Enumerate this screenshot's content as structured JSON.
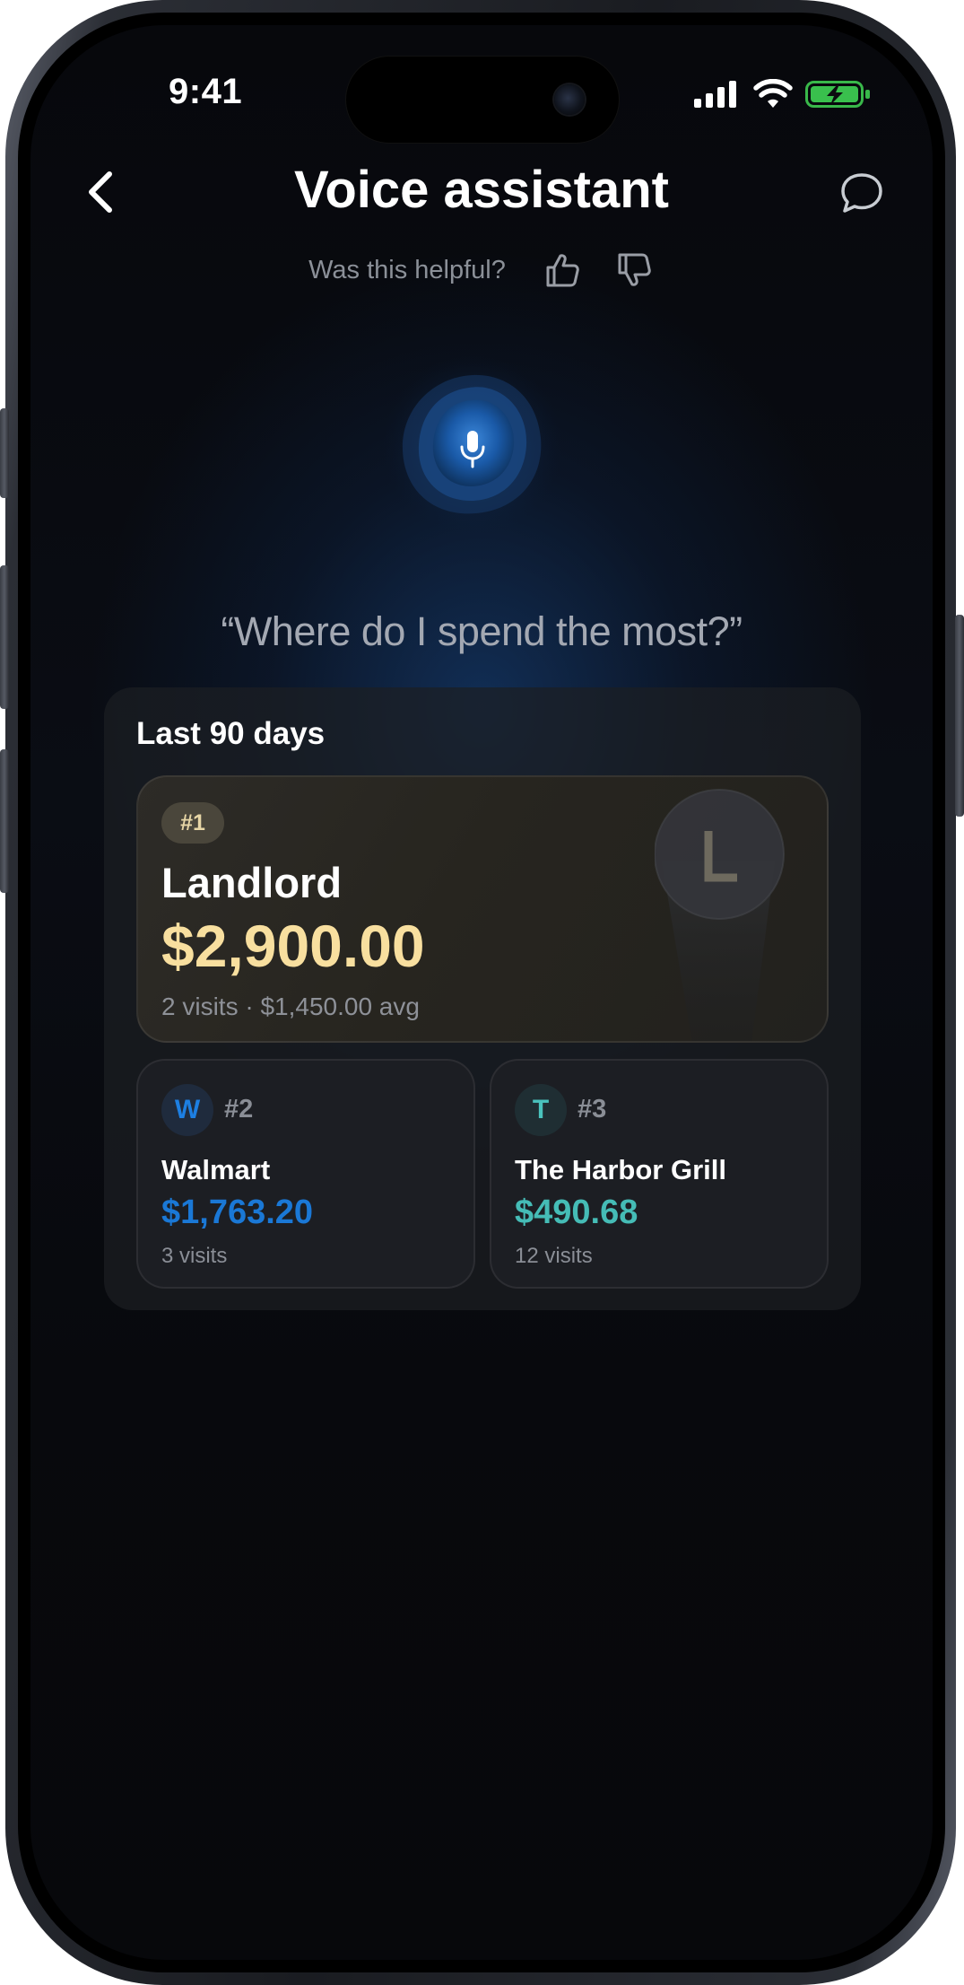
{
  "status_bar": {
    "time": "9:41"
  },
  "header": {
    "title": "Voice assistant",
    "feedback_prompt": "Was this helpful?"
  },
  "query": {
    "text": "“Where do I spend the most?”"
  },
  "results": {
    "period_label": "Last 90 days",
    "top": {
      "rank": "#1",
      "merchant": "Landlord",
      "initial": "L",
      "amount": "$2,900.00",
      "meta": "2 visits · $1,450.00 avg",
      "accent_color": "#f8df9f"
    },
    "others": [
      {
        "rank": "#2",
        "initial": "W",
        "merchant": "Walmart",
        "amount": "$1,763.20",
        "meta": "3 visits",
        "accent_color": "#1a78d6"
      },
      {
        "rank": "#3",
        "initial": "T",
        "merchant": "The Harbor Grill",
        "amount": "$490.68",
        "meta": "12 visits",
        "accent_color": "#45bcb6"
      }
    ]
  },
  "icons": {
    "back": "chevron-left-icon",
    "chat": "chat-bubble-icon",
    "thumbs_up": "thumbs-up-icon",
    "thumbs_down": "thumbs-down-icon",
    "microphone": "microphone-icon"
  }
}
